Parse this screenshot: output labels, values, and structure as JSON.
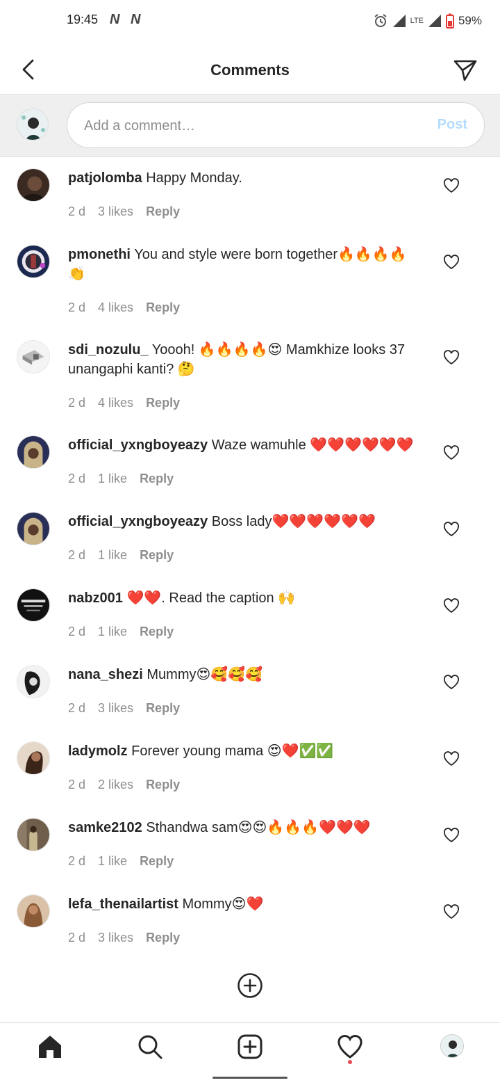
{
  "status": {
    "time": "19:45",
    "battery": "59%",
    "network": "LTE"
  },
  "header": {
    "title": "Comments"
  },
  "composer": {
    "placeholder": "Add a comment…",
    "post_label": "Post"
  },
  "comments": [
    {
      "user": "patjolomba",
      "text": "Happy Monday.",
      "age": "2 d",
      "likes": "3 likes",
      "reply": "Reply"
    },
    {
      "user": "pmonethi",
      "text": "You and style were born together🔥🔥🔥🔥👏",
      "age": "2 d",
      "likes": "4 likes",
      "reply": "Reply"
    },
    {
      "user": "sdi_nozulu_",
      "text": "Yoooh! 🔥🔥🔥🔥😍 Mamkhize looks 37 unangaphi kanti? 🤔",
      "age": "2 d",
      "likes": "4 likes",
      "reply": "Reply"
    },
    {
      "user": "official_yxngboyeazy",
      "text": "Waze wamuhle ❤️❤️❤️❤️❤️❤️",
      "age": "2 d",
      "likes": "1 like",
      "reply": "Reply"
    },
    {
      "user": "official_yxngboyeazy",
      "text": "Boss lady❤️❤️❤️❤️❤️❤️",
      "age": "2 d",
      "likes": "1 like",
      "reply": "Reply"
    },
    {
      "user": "nabz001",
      "text": "❤️❤️. Read the caption 🙌",
      "age": "2 d",
      "likes": "1 like",
      "reply": "Reply"
    },
    {
      "user": "nana_shezi",
      "text": "Mummy😍🥰🥰🥰",
      "age": "2 d",
      "likes": "3 likes",
      "reply": "Reply"
    },
    {
      "user": "ladymolz",
      "text": "Forever young mama 😍❤️✅✅",
      "age": "2 d",
      "likes": "2 likes",
      "reply": "Reply"
    },
    {
      "user": "samke2102",
      "text": "Sthandwa sam😍😍🔥🔥🔥❤️❤️❤️",
      "age": "2 d",
      "likes": "1 like",
      "reply": "Reply"
    },
    {
      "user": "lefa_thenailartist",
      "text": "Mommy😍❤️",
      "age": "2 d",
      "likes": "3 likes",
      "reply": "Reply"
    }
  ],
  "icons": {
    "back": "chevron-left-icon",
    "share": "paper-plane-icon",
    "like": "heart-outline-icon",
    "load_more": "plus-circle-icon"
  },
  "colors": {
    "post_disabled": "#b3dbff",
    "notification_dot": "#ed4956",
    "battery_red": "#e53935"
  }
}
